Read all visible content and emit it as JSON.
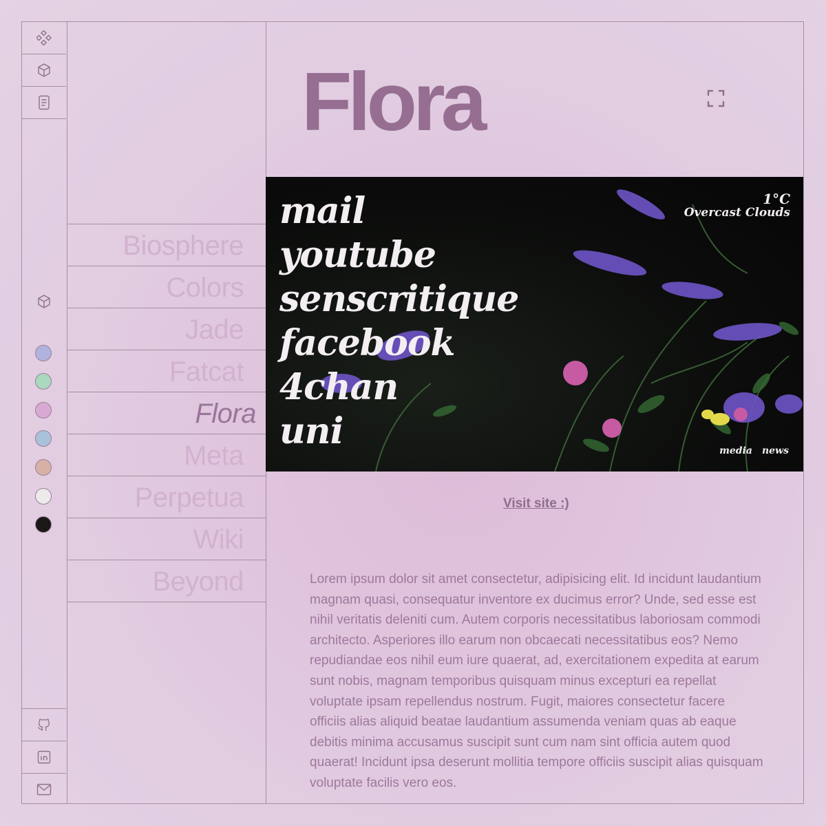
{
  "app": {
    "title": "Flora"
  },
  "rail": {
    "top_icons": [
      "components-icon",
      "cube-icon",
      "document-icon"
    ],
    "mid_icon": "cube-icon",
    "swatches": [
      "#b1b3de",
      "#a9d9be",
      "#d8aad3",
      "#a9c2da",
      "#d8b1a6",
      "#eceaea",
      "#1a1717"
    ],
    "bottom_icons": [
      "github-icon",
      "linkedin-icon",
      "mail-icon"
    ]
  },
  "nav": {
    "items": [
      {
        "label": "Biosphere"
      },
      {
        "label": "Colors"
      },
      {
        "label": "Jade"
      },
      {
        "label": "Fatcat"
      },
      {
        "label": "Flora",
        "active": true
      },
      {
        "label": "Meta"
      },
      {
        "label": "Perpetua"
      },
      {
        "label": "Wiki"
      },
      {
        "label": "Beyond"
      }
    ]
  },
  "main": {
    "title": "Flora",
    "fullscreen_icon": "fullscreen-icon",
    "preview": {
      "links": [
        "mail",
        "youtube",
        "senscritique",
        "facebook",
        "4chan",
        "uni"
      ],
      "weather": {
        "temp": "1°C",
        "condition": "Overcast Clouds"
      },
      "footer_links": [
        "media",
        "news"
      ]
    },
    "visit_link": "Visit site :)",
    "body": "Lorem ipsum dolor sit amet consectetur, adipisicing elit. Id incidunt laudantium magnam quasi, consequatur inventore ex ducimus error? Unde, sed esse est nihil veritatis deleniti cum. Autem corporis necessitatibus laboriosam commodi architecto. Asperiores illo earum non obcaecati necessitatibus eos? Nemo repudiandae eos nihil eum iure quaerat, ad, exercitationem expedita at earum sunt nobis, magnam temporibus quisquam minus excepturi ea repellat voluptate ipsam repellendus nostrum. Fugit, maiores consectetur facere officiis alias aliquid beatae laudantium assumenda veniam quas ab eaque debitis minima accusamus suscipit sunt cum nam sint officia autem quod quaerat! Incidunt ipsa deserunt mollitia tempore officiis suscipit alias quisquam voluptate facilis vero eos."
  }
}
